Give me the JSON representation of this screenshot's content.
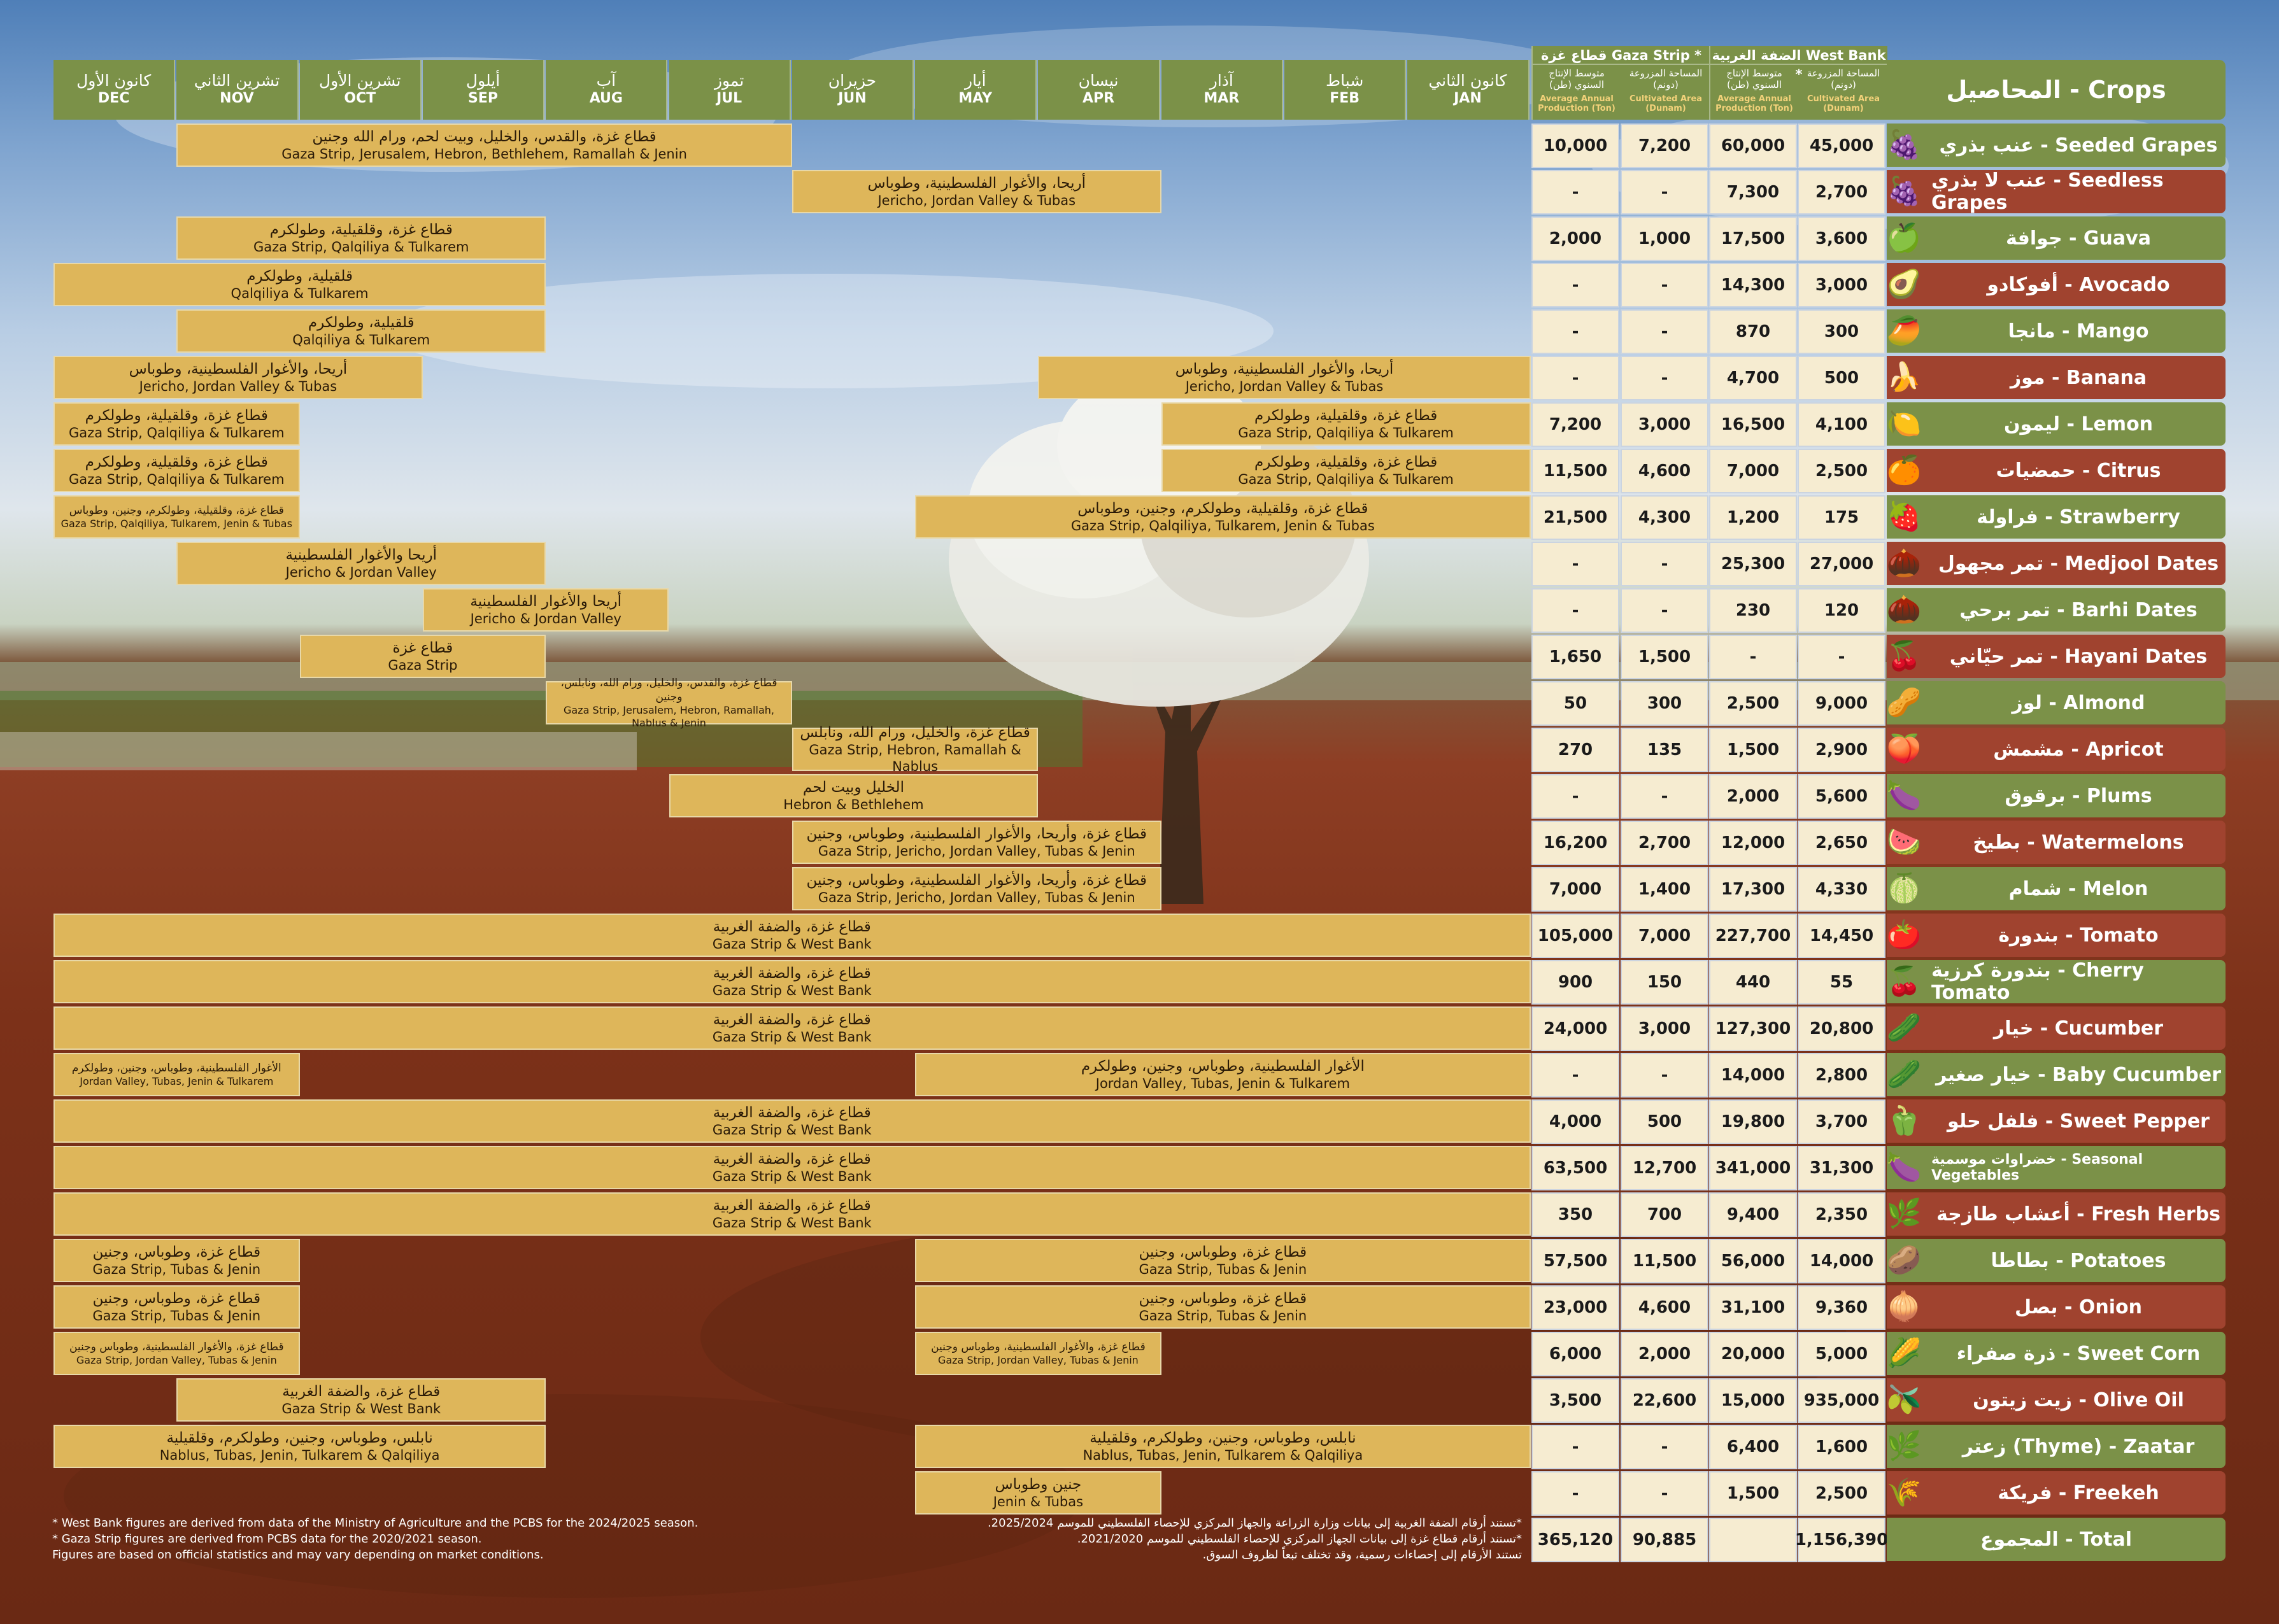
{
  "months": [
    {
      "ar": "كانون الأول",
      "en": "DEC"
    },
    {
      "ar": "تشرين الثاني",
      "en": "NOV"
    },
    {
      "ar": "تشرين الأول",
      "en": "OCT"
    },
    {
      "ar": "أيلول",
      "en": "SEP"
    },
    {
      "ar": "آب",
      "en": "AUG"
    },
    {
      "ar": "تموز",
      "en": "JUL"
    },
    {
      "ar": "حزيران",
      "en": "JUN"
    },
    {
      "ar": "أيار",
      "en": "MAY"
    },
    {
      "ar": "نيسان",
      "en": "APR"
    },
    {
      "ar": "آذار",
      "en": "MAR"
    },
    {
      "ar": "شباط",
      "en": "FEB"
    },
    {
      "ar": "كانون الثاني",
      "en": "JAN"
    }
  ],
  "header": {
    "crops_title": "المحاصيل - Crops",
    "gaza_title": "قطاع غزة Gaza Strip *",
    "westbank_title": "الضفة الغربية West Bank *",
    "col_prod_ar": "متوسط الإنتاج السنوي (طن)",
    "col_prod_en": "Average Annual Production (Ton)",
    "col_area_ar": "المساحة المزروعة (دونم)",
    "col_area_en": "Cultivated Area (Dunam)"
  },
  "crops": [
    {
      "name": "عنب بذري - Seeded Grapes",
      "color": "#7b9148",
      "icon": "grapes-icon",
      "glyph": "🍇",
      "g_prod": "10,000",
      "g_area": "7,200",
      "w_prod": "60,000",
      "w_area": "45,000",
      "bars": [
        {
          "from": 1,
          "to": 5,
          "ar": "قطاع غزة، والقدس، والخليل، وبيت لحم، ورام الله وجنين",
          "en": "Gaza Strip, Jerusalem, Hebron, Bethlehem, Ramallah & Jenin"
        }
      ]
    },
    {
      "name": "عنب لا بذري - Seedless Grapes",
      "color": "#a0432f",
      "icon": "grapes-icon",
      "glyph": "🍇",
      "g_prod": "-",
      "g_area": "-",
      "w_prod": "7,300",
      "w_area": "2,700",
      "bars": [
        {
          "from": 6,
          "to": 8,
          "ar": "أريحا، والأغوار الفلسطينية، وطوباس",
          "en": "Jericho, Jordan Valley & Tubas"
        }
      ]
    },
    {
      "name": "جوافة - Guava",
      "color": "#7b9148",
      "icon": "guava-icon",
      "glyph": "🍏",
      "g_prod": "2,000",
      "g_area": "1,000",
      "w_prod": "17,500",
      "w_area": "3,600",
      "bars": [
        {
          "from": 1,
          "to": 3,
          "ar": "قطاع غزة، وقلقيلية، وطولكرم",
          "en": "Gaza Strip, Qalqiliya & Tulkarem"
        }
      ]
    },
    {
      "name": "أفوكادو - Avocado",
      "color": "#a0432f",
      "icon": "avocado-icon",
      "glyph": "🥑",
      "g_prod": "-",
      "g_area": "-",
      "w_prod": "14,300",
      "w_area": "3,000",
      "bars": [
        {
          "from": 0,
          "to": 3,
          "ar": "قلقيلية، وطولكرم",
          "en": "Qalqiliya & Tulkarem"
        }
      ]
    },
    {
      "name": "مانجا - Mango",
      "color": "#7b9148",
      "icon": "mango-icon",
      "glyph": "🥭",
      "g_prod": "-",
      "g_area": "-",
      "w_prod": "870",
      "w_area": "300",
      "bars": [
        {
          "from": 1,
          "to": 3,
          "ar": "قلقيلية، وطولكرم",
          "en": "Qalqiliya & Tulkarem"
        }
      ]
    },
    {
      "name": "موز - Banana",
      "color": "#a0432f",
      "icon": "banana-icon",
      "glyph": "🍌",
      "g_prod": "-",
      "g_area": "-",
      "w_prod": "4,700",
      "w_area": "500",
      "bars": [
        {
          "from": 0,
          "to": 2,
          "ar": "أريحا، والأغوار الفلسطينية، وطوباس",
          "en": "Jericho, Jordan Valley & Tubas"
        },
        {
          "from": 8,
          "to": 11,
          "ar": "أريحا، والأغوار الفلسطينية، وطوباس",
          "en": "Jericho, Jordan Valley & Tubas"
        }
      ]
    },
    {
      "name": "ليمون - Lemon",
      "color": "#7b9148",
      "icon": "lemon-icon",
      "glyph": "🍋",
      "g_prod": "7,200",
      "g_area": "3,000",
      "w_prod": "16,500",
      "w_area": "4,100",
      "bars": [
        {
          "from": 0,
          "to": 1,
          "ar": "قطاع غزة، وقلقيلية، وطولكرم",
          "en": "Gaza Strip, Qalqiliya & Tulkarem"
        },
        {
          "from": 9,
          "to": 11,
          "ar": "قطاع غزة، وقلقيلية، وطولكرم",
          "en": "Gaza Strip, Qalqiliya & Tulkarem"
        }
      ]
    },
    {
      "name": "حمضيات - Citrus",
      "color": "#a0432f",
      "icon": "orange-icon",
      "glyph": "🍊",
      "g_prod": "11,500",
      "g_area": "4,600",
      "w_prod": "7,000",
      "w_area": "2,500",
      "bars": [
        {
          "from": 0,
          "to": 1,
          "ar": "قطاع غزة، وقلقيلية، وطولكرم",
          "en": "Gaza Strip, Qalqiliya & Tulkarem"
        },
        {
          "from": 9,
          "to": 11,
          "ar": "قطاع غزة، وقلقيلية، وطولكرم",
          "en": "Gaza Strip, Qalqiliya & Tulkarem"
        }
      ]
    },
    {
      "name": "فراولة - Strawberry",
      "color": "#7b9148",
      "icon": "strawberry-icon",
      "glyph": "🍓",
      "g_prod": "21,500",
      "g_area": "4,300",
      "w_prod": "1,200",
      "w_area": "175",
      "bars": [
        {
          "from": 0,
          "to": 1,
          "small": true,
          "ar": "قطاع غزة، وقلقيلية، وطولكرم، وجنين، وطوباس",
          "en": "Gaza Strip, Qalqiliya, Tulkarem, Jenin & Tubas"
        },
        {
          "from": 7,
          "to": 11,
          "ar": "قطاع غزة، وقلقيلية، وطولكرم، وجنين، وطوباس",
          "en": "Gaza Strip, Qalqiliya, Tulkarem, Jenin & Tubas"
        }
      ]
    },
    {
      "name": "تمر مجهول - Medjool Dates",
      "color": "#a0432f",
      "icon": "dates-icon",
      "glyph": "🌰",
      "g_prod": "-",
      "g_area": "-",
      "w_prod": "25,300",
      "w_area": "27,000",
      "bars": [
        {
          "from": 1,
          "to": 3,
          "ar": "أريحا والأغوار الفلسطينية",
          "en": "Jericho & Jordan Valley"
        }
      ]
    },
    {
      "name": "تمر برحي - Barhi Dates",
      "color": "#7b9148",
      "icon": "dates-icon",
      "glyph": "🌰",
      "g_prod": "-",
      "g_area": "-",
      "w_prod": "230",
      "w_area": "120",
      "bars": [
        {
          "from": 3,
          "to": 4,
          "ar": "أريحا والأغوار الفلسطينية",
          "en": "Jericho & Jordan Valley"
        }
      ]
    },
    {
      "name": "تمر حيّاني - Hayani Dates",
      "color": "#a0432f",
      "icon": "dates-icon",
      "glyph": "🍒",
      "g_prod": "1,650",
      "g_area": "1,500",
      "w_prod": "-",
      "w_area": "-",
      "bars": [
        {
          "from": 2,
          "to": 3,
          "ar": "قطاع غزة",
          "en": "Gaza Strip"
        }
      ]
    },
    {
      "name": "لوز - Almond",
      "color": "#7b9148",
      "icon": "almond-icon",
      "glyph": "🥜",
      "g_prod": "50",
      "g_area": "300",
      "w_prod": "2,500",
      "w_area": "9,000",
      "bars": [
        {
          "from": 4,
          "to": 5,
          "small": true,
          "ar": "قطاع غزة، والقدس، والخليل، ورام الله، ونابلس، وجنين",
          "en": "Gaza Strip, Jerusalem, Hebron, Ramallah, Nablus & Jenin"
        }
      ]
    },
    {
      "name": "مشمش - Apricot",
      "color": "#a0432f",
      "icon": "apricot-icon",
      "glyph": "🍑",
      "g_prod": "270",
      "g_area": "135",
      "w_prod": "1,500",
      "w_area": "2,900",
      "bars": [
        {
          "from": 6,
          "to": 7,
          "ar": "قطاع غزة، والخليل، ورام الله، ونابلس",
          "en": "Gaza Strip, Hebron, Ramallah & Nablus"
        }
      ]
    },
    {
      "name": "برقوق - Plums",
      "color": "#7b9148",
      "icon": "plum-icon",
      "glyph": "🍆",
      "g_prod": "-",
      "g_area": "-",
      "w_prod": "2,000",
      "w_area": "5,600",
      "bars": [
        {
          "from": 5,
          "to": 7,
          "ar": "الخليل وبيت لحم",
          "en": "Hebron & Bethlehem"
        }
      ]
    },
    {
      "name": "بطيخ - Watermelons",
      "color": "#a0432f",
      "icon": "watermelon-icon",
      "glyph": "🍉",
      "g_prod": "16,200",
      "g_area": "2,700",
      "w_prod": "12,000",
      "w_area": "2,650",
      "bars": [
        {
          "from": 6,
          "to": 8,
          "ar": "قطاع غزة، وأريحا، والأغوار الفلسطينية، وطوباس، وجنين",
          "en": "Gaza Strip, Jericho, Jordan Valley, Tubas & Jenin"
        }
      ]
    },
    {
      "name": "شمام - Melon",
      "color": "#7b9148",
      "icon": "melon-icon",
      "glyph": "🍈",
      "g_prod": "7,000",
      "g_area": "1,400",
      "w_prod": "17,300",
      "w_area": "4,330",
      "bars": [
        {
          "from": 6,
          "to": 8,
          "ar": "قطاع غزة، وأريحا، والأغوار الفلسطينية، وطوباس، وجنين",
          "en": "Gaza Strip, Jericho, Jordan Valley, Tubas & Jenin"
        }
      ]
    },
    {
      "name": "بندورة - Tomato",
      "color": "#a0432f",
      "icon": "tomato-icon",
      "glyph": "🍅",
      "g_prod": "105,000",
      "g_area": "7,000",
      "w_prod": "227,700",
      "w_area": "14,450",
      "bars": [
        {
          "from": 0,
          "to": 11,
          "ar": "قطاع غزة، والضفة الغربية",
          "en": "Gaza Strip & West Bank"
        }
      ]
    },
    {
      "name": "بندورة كرزية - Cherry Tomato",
      "color": "#7b9148",
      "icon": "tomato-icon",
      "glyph": "🍒",
      "g_prod": "900",
      "g_area": "150",
      "w_prod": "440",
      "w_area": "55",
      "bars": [
        {
          "from": 0,
          "to": 11,
          "ar": "قطاع غزة، والضفة الغربية",
          "en": "Gaza Strip & West Bank"
        }
      ]
    },
    {
      "name": "خيار - Cucumber",
      "color": "#a0432f",
      "icon": "cucumber-icon",
      "glyph": "🥒",
      "g_prod": "24,000",
      "g_area": "3,000",
      "w_prod": "127,300",
      "w_area": "20,800",
      "bars": [
        {
          "from": 0,
          "to": 11,
          "ar": "قطاع غزة، والضفة الغربية",
          "en": "Gaza Strip & West Bank"
        }
      ]
    },
    {
      "name": "خيار صغير - Baby Cucumber",
      "color": "#7b9148",
      "icon": "cucumber-icon",
      "glyph": "🥒",
      "g_prod": "-",
      "g_area": "-",
      "w_prod": "14,000",
      "w_area": "2,800",
      "bars": [
        {
          "from": 0,
          "to": 1,
          "small": true,
          "ar": "الأغوار الفلسطينية، وطوباس، وجنين، وطولكرم",
          "en": "Jordan Valley, Tubas, Jenin & Tulkarem"
        },
        {
          "from": 7,
          "to": 11,
          "ar": "الأغوار الفلسطينية، وطوباس، وجنين، وطولكرم",
          "en": "Jordan Valley, Tubas, Jenin & Tulkarem"
        }
      ]
    },
    {
      "name": "فلفل حلو - Sweet Pepper",
      "color": "#a0432f",
      "icon": "pepper-icon",
      "glyph": "🫑",
      "g_prod": "4,000",
      "g_area": "500",
      "w_prod": "19,800",
      "w_area": "3,700",
      "bars": [
        {
          "from": 0,
          "to": 11,
          "ar": "قطاع غزة، والضفة الغربية",
          "en": "Gaza Strip & West Bank"
        }
      ]
    },
    {
      "name": "خضراوات موسمية - Seasonal Vegetables",
      "color": "#7b9148",
      "icon": "eggplant-icon",
      "glyph": "🍆",
      "small": true,
      "g_prod": "63,500",
      "g_area": "12,700",
      "w_prod": "341,000",
      "w_area": "31,300",
      "bars": [
        {
          "from": 0,
          "to": 11,
          "ar": "قطاع غزة، والضفة الغربية",
          "en": "Gaza Strip & West Bank"
        }
      ]
    },
    {
      "name": "أعشاب طازجة - Fresh Herbs",
      "color": "#a0432f",
      "icon": "herbs-icon",
      "glyph": "🌿",
      "g_prod": "350",
      "g_area": "700",
      "w_prod": "9,400",
      "w_area": "2,350",
      "bars": [
        {
          "from": 0,
          "to": 11,
          "ar": "قطاع غزة، والضفة الغربية",
          "en": "Gaza Strip & West Bank"
        }
      ]
    },
    {
      "name": "بطاطا - Potatoes",
      "color": "#7b9148",
      "icon": "potato-icon",
      "glyph": "🥔",
      "g_prod": "57,500",
      "g_area": "11,500",
      "w_prod": "56,000",
      "w_area": "14,000",
      "bars": [
        {
          "from": 0,
          "to": 1,
          "ar": "قطاع غزة، وطوباس، وجنين",
          "en": "Gaza Strip, Tubas & Jenin"
        },
        {
          "from": 7,
          "to": 11,
          "ar": "قطاع غزة، وطوباس، وجنين",
          "en": "Gaza Strip, Tubas & Jenin"
        }
      ]
    },
    {
      "name": "بصل - Onion",
      "color": "#a0432f",
      "icon": "onion-icon",
      "glyph": "🧅",
      "g_prod": "23,000",
      "g_area": "4,600",
      "w_prod": "31,100",
      "w_area": "9,360",
      "bars": [
        {
          "from": 0,
          "to": 1,
          "ar": "قطاع غزة، وطوباس، وجنين",
          "en": "Gaza Strip, Tubas & Jenin"
        },
        {
          "from": 7,
          "to": 11,
          "ar": "قطاع غزة، وطوباس، وجنين",
          "en": "Gaza Strip, Tubas & Jenin"
        }
      ]
    },
    {
      "name": "ذرة صفراء - Sweet Corn",
      "color": "#7b9148",
      "icon": "corn-icon",
      "glyph": "🌽",
      "g_prod": "6,000",
      "g_area": "2,000",
      "w_prod": "20,000",
      "w_area": "5,000",
      "bars": [
        {
          "from": 0,
          "to": 1,
          "small": true,
          "ar": "قطاع غزة، والأغوار الفلسطينية، وطوباس وجنين",
          "en": "Gaza Strip, Jordan Valley, Tubas & Jenin"
        },
        {
          "from": 7,
          "to": 8,
          "small": true,
          "ar": "قطاع غزة، والأغوار الفلسطينية، وطوباس وجنين",
          "en": "Gaza Strip, Jordan Valley, Tubas & Jenin"
        }
      ]
    },
    {
      "name": "زيت زيتون - Olive Oil",
      "color": "#a0432f",
      "icon": "olive-oil-icon",
      "glyph": "🫒",
      "g_prod": "3,500",
      "g_area": "22,600",
      "w_prod": "15,000",
      "w_area": "935,000",
      "bars": [
        {
          "from": 1,
          "to": 3,
          "ar": "قطاع غزة، والضفة الغربية",
          "en": "Gaza Strip & West Bank"
        }
      ]
    },
    {
      "name": "زعتر (Thyme) - Zaatar",
      "color": "#7b9148",
      "icon": "thyme-icon",
      "glyph": "🌿",
      "g_prod": "-",
      "g_area": "-",
      "w_prod": "6,400",
      "w_area": "1,600",
      "bars": [
        {
          "from": 0,
          "to": 3,
          "ar": "نابلس، وطوباس، وجنين، وطولكرم، وقلقيلية",
          "en": "Nablus, Tubas, Jenin, Tulkarem & Qalqiliya"
        },
        {
          "from": 7,
          "to": 11,
          "ar": "نابلس، وطوباس، وجنين، وطولكرم، وقلقيلية",
          "en": "Nablus, Tubas, Jenin, Tulkarem & Qalqiliya"
        }
      ]
    },
    {
      "name": "فريكة - Freekeh",
      "color": "#a0432f",
      "icon": "wheat-icon",
      "glyph": "🌾",
      "g_prod": "-",
      "g_area": "-",
      "w_prod": "1,500",
      "w_area": "2,500",
      "bars": [
        {
          "from": 7,
          "to": 8,
          "ar": "جنين وطوباس",
          "en": "Jenin & Tubas"
        }
      ]
    }
  ],
  "total": {
    "label": "المجموع - Total",
    "g_prod": "365,120",
    "g_area": "90,885",
    "w_prod": "",
    "w_area": "1,156,390"
  },
  "notes": {
    "en1": "* West Bank figures are derived from data of the Ministry of Agriculture and the PCBS for the 2024/2025 season.",
    "en2": "* Gaza Strip figures are derived from PCBS data for the 2020/2021 season.",
    "en3": "Figures are based on official statistics and may vary depending on market conditions.",
    "ar1": "*تستند أرقام الضفة الغربية إلى بيانات وزارة الزراعة والجهاز المركزي للإحصاء الفلسطيني للموسم 2025/2024.",
    "ar2": "*تستند أرقام قطاع غزة إلى بيانات الجهاز المركزي للإحصاء الفلسطيني للموسم 2021/2020.",
    "ar3": "تستند الأرقام إلى إحصاءات رسمية، وقد تختلف تبعاً لظروف السوق."
  }
}
